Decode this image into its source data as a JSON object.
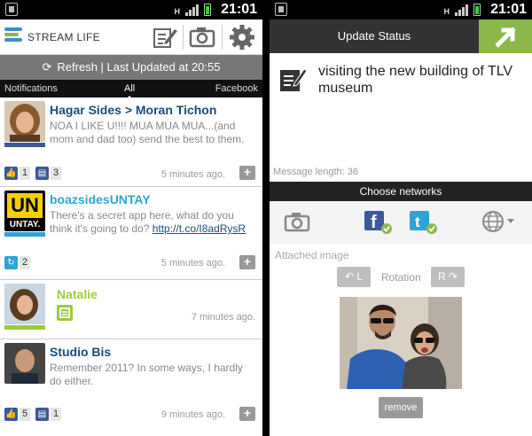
{
  "status_time": "21:01",
  "status_data": "H",
  "stream": {
    "logo_text": "STREAM LIFE",
    "refresh_text": "Refresh | Last Updated at 20:55",
    "tabs": [
      "Notifications",
      "All",
      "Facebook"
    ],
    "posts": [
      {
        "name": "Hagar Sides > Moran Tichon",
        "text": "NOA I LIKE U!!!! MUA MUA MUA...(and mom and dad too) send the best to them.",
        "time": "5 minutes ago.",
        "likes": "1",
        "comments": "3"
      },
      {
        "name": "boazsidesUNTAY",
        "text": "There's a secret app here, what do you think it's going to do?",
        "link": "http://t.co/I8adRysR",
        "time": "5 minutes ago.",
        "retweets": "2",
        "avatar_text_top": "UN",
        "avatar_text_bottom": "UNTAY."
      },
      {
        "name": "Natalie",
        "time": "7 minutes ago."
      },
      {
        "name": "Studio  Bis",
        "text": "Remember 2011? In some ways, I hardly do either.",
        "time": "9 minutes ago.",
        "likes": "5",
        "comments": "1"
      }
    ]
  },
  "update": {
    "title": "Update Status",
    "message": "visiting the new building of TLV museum",
    "message_length": "Message length: 36",
    "networks_title": "Choose networks",
    "attached_label": "Attached image",
    "rotation_label": "Rotation",
    "rotate_left_label": "L",
    "rotate_right_label": "R",
    "remove_label": "remove"
  },
  "colors": {
    "facebook": "#3b5998",
    "twitter": "#2fa3d6",
    "accent_green": "#8cb84b",
    "natalie_green": "#9ccc3a",
    "link_blue": "#1a4c7c"
  }
}
